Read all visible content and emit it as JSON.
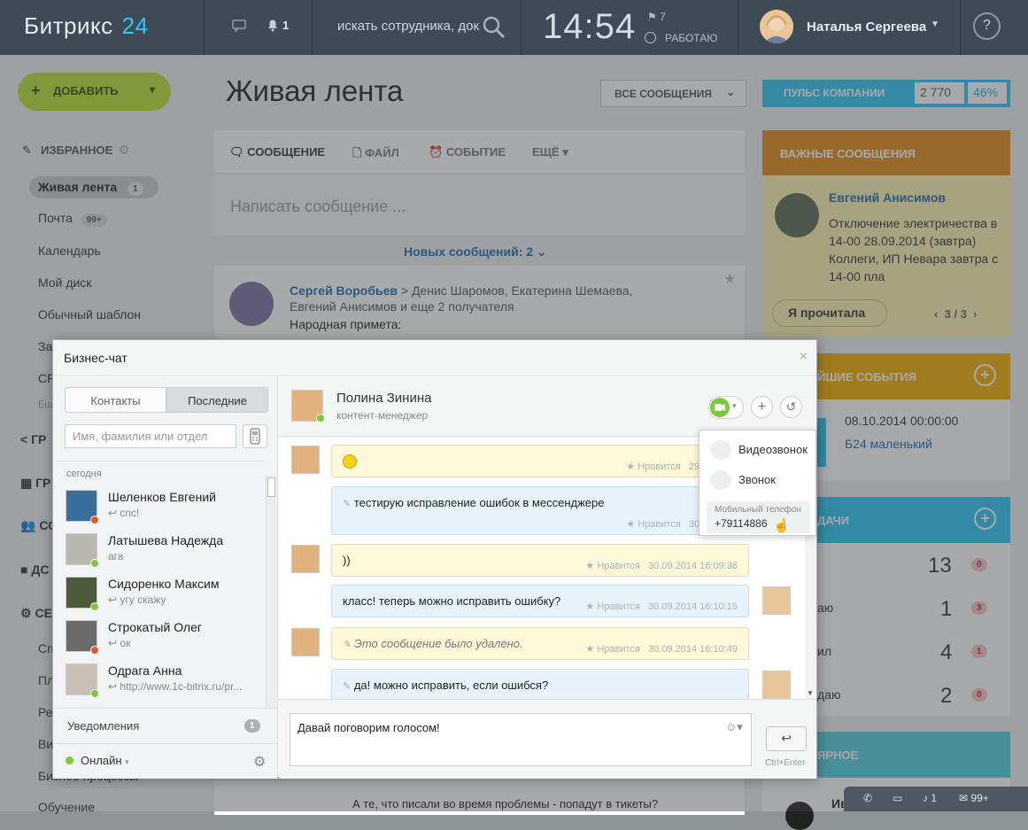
{
  "header": {
    "logo": "Битрикс",
    "logo_num": "24",
    "notif_count": "1",
    "search_placeholder": "искать сотрудника, док",
    "time": "14:54",
    "flag_count": "7",
    "work_status": "РАБОТАЮ",
    "user_name": "Наталья Сергеева",
    "help": "?"
  },
  "page": {
    "add_button": "ДОБАВИТЬ",
    "title": "Живая лента",
    "all_messages": "ВСЕ СООБЩЕНИЯ",
    "pulse_label": "ПУЛЬС КОМПАНИИ",
    "pulse_value": "2 770",
    "pulse_percent": "46%",
    "favorites": "ИЗБРАННОЕ",
    "sidebar": [
      {
        "label": "Живая лента",
        "count": "1"
      },
      {
        "label": "Почта",
        "count": "99+"
      },
      {
        "label": "Календарь"
      },
      {
        "label": "Мой диск"
      },
      {
        "label": "Обычный шаблон"
      },
      {
        "label": "За"
      },
      {
        "label": "CF"
      },
      {
        "label": "Еш"
      }
    ],
    "sidebar_lower": [
      "ГР",
      "ГР",
      "СО",
      "ДС",
      "СЕ",
      "Сп",
      "Пл",
      "Ре",
      "Ви",
      "Бизнес-процессы",
      "Обучение"
    ],
    "tabs": [
      "СООБЩЕНИЕ",
      "ФАЙЛ",
      "СОБЫТИЕ",
      "ЕЩЁ"
    ],
    "composer_placeholder": "Написать сообщение ...",
    "new_messages": "Новых сообщений: 2",
    "post_author": "Сергей Воробьев",
    "post_recipients": "Денис Шаромов, Екатерина Шемаева, Евгений Анисимов  и еще 2 получателя",
    "post_text": "Народная примета:",
    "post_comment": "А те, что писали во время проблемы - попадут в тикеты?",
    "important_title": "ВАЖНЫЕ СООБЩЕНИЯ",
    "important_author": "Евгений Анисимов",
    "important_text": "Отключение электричества в 14-00 28.09.2014 (завтра) Коллеги, ИП Невара завтра с 14-00 пла",
    "important_read": "Я прочитала",
    "important_page": "3",
    "important_total": "3",
    "events_title": "ЙШИЕ СОБЫТИЯ",
    "event_date": "08.10.2014 00:00:00",
    "event_name": "Б24 маленький",
    "tasks_title": "ДАЧИ",
    "tasks": [
      {
        "label": "",
        "num": "13",
        "badge": "0"
      },
      {
        "label": "аю",
        "num": "1",
        "badge": "3"
      },
      {
        "label": "ил",
        "num": "4",
        "badge": "1"
      },
      {
        "label": "даю",
        "num": "2",
        "badge": "0"
      }
    ],
    "popular_title": "ЯРНОЕ",
    "bottom_user": "Ив"
  },
  "chat": {
    "title": "Бизнес-чат",
    "tab_contacts": "Контакты",
    "tab_recent": "Последние",
    "search_placeholder": "Имя, фамилия или отдел",
    "today": "сегодня",
    "contacts": [
      {
        "name": "Шеленков Евгений",
        "last": "спс!",
        "status": "busy"
      },
      {
        "name": "Латышева Надежда",
        "last": "ага",
        "status": "online"
      },
      {
        "name": "Сидоренко Максим",
        "last": "угу скажу",
        "status": "online"
      },
      {
        "name": "Строкатый Олег",
        "last": "ок",
        "status": "busy"
      },
      {
        "name": "Одрага Анна",
        "last": "http://www.1c-bitrix.ru/pr...",
        "status": "online"
      }
    ],
    "notifications": "Уведомления",
    "notifications_count": "1",
    "status": "Онлайн",
    "peer_name": "Полина Зинина",
    "peer_role": "контент-менеджер",
    "like": "Нравится",
    "messages": [
      {
        "text": "",
        "time": "29.09.2014",
        "side": "left",
        "smile": true,
        "color": "y"
      },
      {
        "text": "тестирую исправление ошибок  в мессенджере",
        "time": "30.09.2014",
        "side": "left-indent",
        "color": "b"
      },
      {
        "text": "))",
        "time": "30.09.2014 16:09:36",
        "side": "left",
        "color": "y"
      },
      {
        "text": "класс! теперь можно исправить ошибку?",
        "time": "30.09.2014 16:10:15",
        "side": "right",
        "color": "b"
      },
      {
        "text": "Это сообщение было удалено.",
        "time": "30.09.2014 16:10:49",
        "side": "left",
        "color": "y"
      },
      {
        "text": "да! можно исправить, если ошибся?",
        "time": "",
        "side": "right",
        "color": "b"
      }
    ],
    "input_text": "Давай поговорим голосом!",
    "send_hint": "Ctrl+Enter",
    "call_menu": {
      "video": "Видеозвонок",
      "call": "Звонок",
      "mobile_label": "Мобильный телефон",
      "mobile_number": "+79114886"
    }
  },
  "tray": {
    "notif": "1",
    "mail": "99+"
  }
}
